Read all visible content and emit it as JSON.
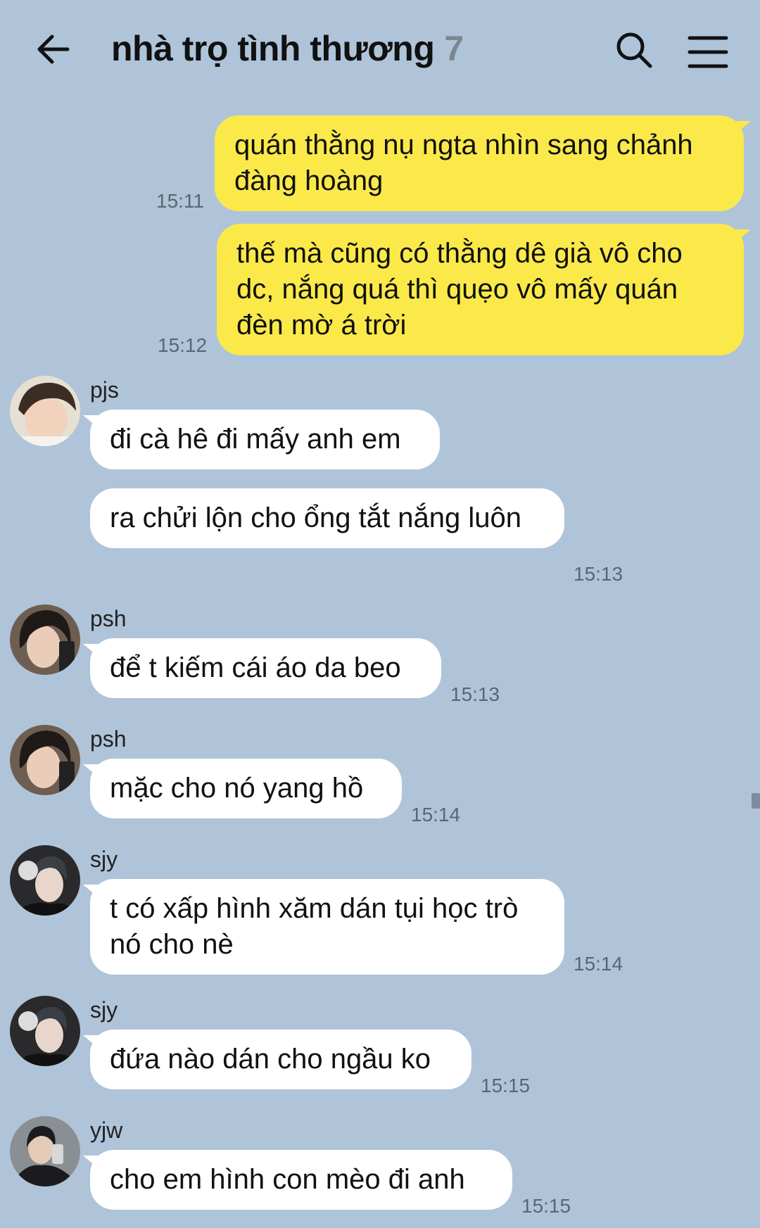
{
  "header": {
    "title": "nhà trọ tình thương",
    "member_count": "7"
  },
  "messages": [
    {
      "sender": "me",
      "text": "quán thằng nụ ngta nhìn sang chảnh đàng hoàng",
      "time": "15:11"
    },
    {
      "sender": "me",
      "text": "thế mà cũng có thằng dê già vô cho dc, nắng quá thì quẹo vô mấy quán đèn mờ á trời",
      "time": "15:12"
    },
    {
      "sender": "pjs",
      "text": "đi cà hê đi mấy anh em"
    },
    {
      "sender": "pjs",
      "text": "ra chửi lộn cho ổng tắt nắng luôn",
      "time": "15:13"
    },
    {
      "sender": "psh",
      "text": "để t kiếm cái áo da beo",
      "time": "15:13"
    },
    {
      "sender": "psh",
      "text": "mặc cho nó yang hồ",
      "time": "15:14"
    },
    {
      "sender": "sjy",
      "text": "t có xấp hình xăm dán tụi học trò nó cho nè",
      "time": "15:14"
    },
    {
      "sender": "sjy",
      "text": "đứa nào dán cho ngầu ko",
      "time": "15:15"
    },
    {
      "sender": "yjw",
      "text": "cho em hình con mèo đi anh",
      "time": "15:15"
    }
  ],
  "colors": {
    "background": "#b0c4d9",
    "my_bubble": "#fbe94a",
    "other_bubble": "#ffffff"
  },
  "icons": [
    "back-arrow-icon",
    "search-icon",
    "hamburger-menu-icon"
  ]
}
